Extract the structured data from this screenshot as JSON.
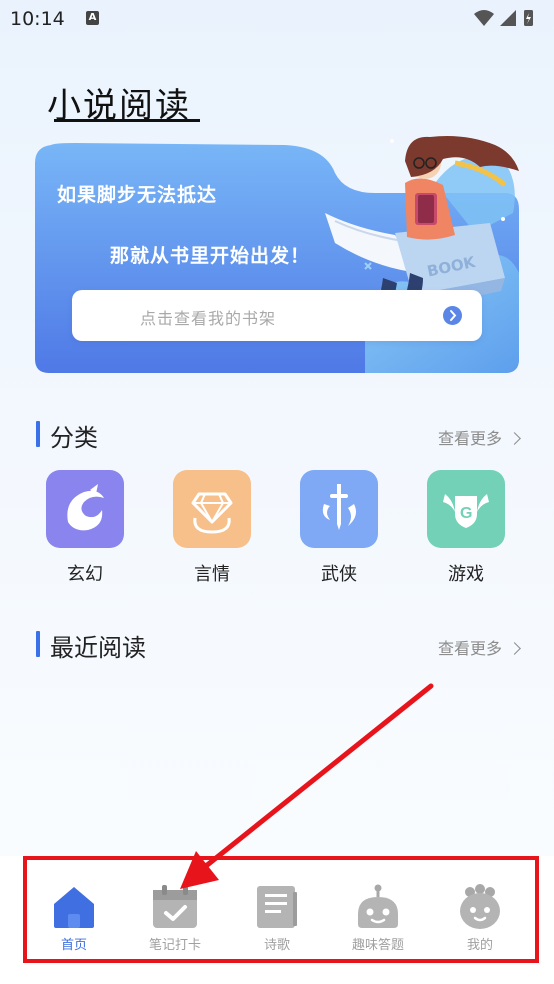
{
  "status_bar": {
    "time": "10:14",
    "notification_badge": "A"
  },
  "header": {
    "title": "小说阅读"
  },
  "banner": {
    "line1": "如果脚步无法抵达",
    "line2": "那就从书里开始出发！",
    "book_text": "BOOK",
    "shelf_button_label": "点击查看我的书架"
  },
  "categories_section": {
    "title": "分类",
    "more_label": "查看更多",
    "items": [
      {
        "label": "玄幻",
        "color": "#8a84ee",
        "icon": "dragon-icon"
      },
      {
        "label": "言情",
        "color": "#f7c08a",
        "icon": "diamond-icon"
      },
      {
        "label": "武侠",
        "color": "#7fa9f5",
        "icon": "sword-icon"
      },
      {
        "label": "游戏",
        "color": "#73d1b7",
        "icon": "game-shield-icon"
      }
    ]
  },
  "recent_section": {
    "title": "最近阅读",
    "more_label": "查看更多"
  },
  "bottom_nav": {
    "items": [
      {
        "label": "首页",
        "icon": "home-icon",
        "active": true
      },
      {
        "label": "笔记打卡",
        "icon": "calendar-check-icon",
        "active": false
      },
      {
        "label": "诗歌",
        "icon": "document-icon",
        "active": false
      },
      {
        "label": "趣味答题",
        "icon": "robot-icon",
        "active": false
      },
      {
        "label": "我的",
        "icon": "profile-icon",
        "active": false
      }
    ]
  },
  "colors": {
    "accent": "#3f6fe0",
    "banner": "#5b8ff0",
    "annotation": "#e8141c"
  }
}
